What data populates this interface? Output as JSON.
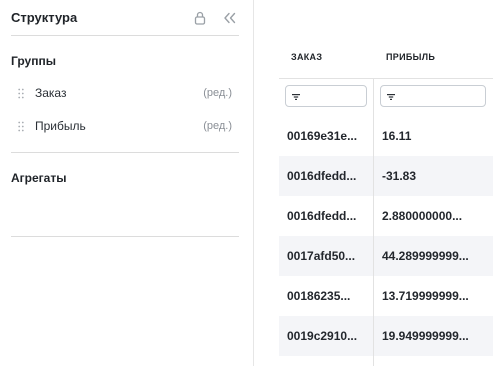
{
  "panel": {
    "title": "Структура",
    "icons": [
      "lock-icon",
      "double-chevron-left-icon"
    ]
  },
  "groups": {
    "title": "Группы",
    "items": [
      {
        "label": "Заказ",
        "edit": "(ред.)"
      },
      {
        "label": "Прибыль",
        "edit": "(ред.)"
      }
    ]
  },
  "aggregates": {
    "title": "Агрегаты"
  },
  "table": {
    "columns": [
      {
        "header": "ЗАКАЗ",
        "filter_icon": "filter-icon"
      },
      {
        "header": "ПРИБЫЛЬ",
        "filter_icon": "filter-icon"
      }
    ],
    "rows": [
      [
        "00169e31e...",
        "16.11"
      ],
      [
        "0016dfedd...",
        "-31.83"
      ],
      [
        "0016dfedd...",
        "2.880000000..."
      ],
      [
        "0017afd50...",
        "44.289999999..."
      ],
      [
        "00186235...",
        "13.719999999..."
      ],
      [
        "0019c2910...",
        "19.949999999..."
      ]
    ]
  },
  "colors": {
    "row_alt": "#f4f5f8",
    "divider": "#dcdcdc",
    "muted_text": "#8a8f96"
  }
}
